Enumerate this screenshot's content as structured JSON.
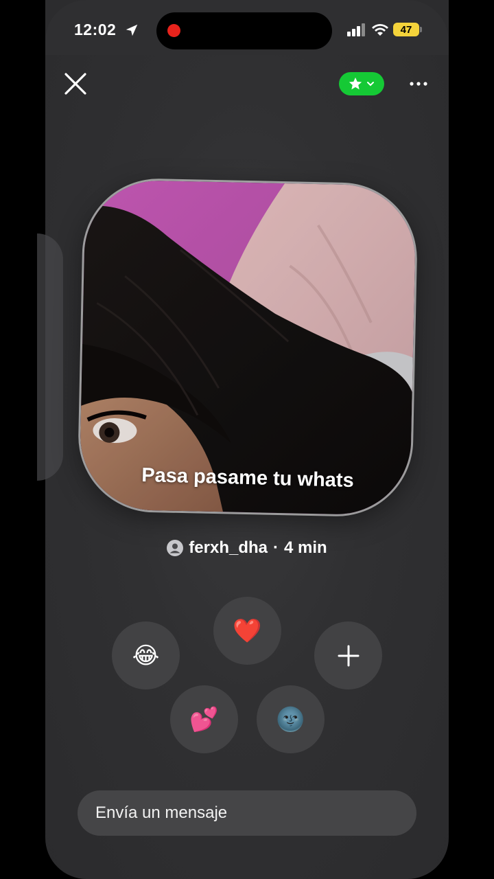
{
  "status_bar": {
    "time": "12:02",
    "battery": "47"
  },
  "toolbar": {
    "close_icon": "close-icon",
    "favorite_icon": "star-icon",
    "more_icon": "more-horizontal-icon",
    "favorite_color": "#15c935"
  },
  "post": {
    "caption": "Pasa pasame tu whats",
    "author": "ferxh_dha",
    "separator": "·",
    "age": "4 min"
  },
  "reactions": {
    "laugh": "😂",
    "heart": "❤️",
    "add_icon": "plus-icon",
    "two_hearts": "💕",
    "moon": "🌚"
  },
  "composer": {
    "placeholder": "Envía un mensaje"
  }
}
